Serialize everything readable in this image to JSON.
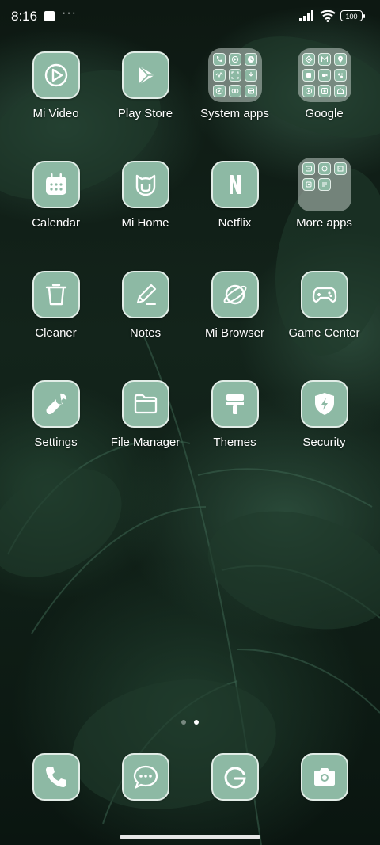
{
  "status_bar": {
    "time": "8:16",
    "overflow": "···",
    "battery": "100"
  },
  "apps": {
    "mi_video": "Mi Video",
    "play_store": "Play Store",
    "system_apps": "System apps",
    "google": "Google",
    "calendar": "Calendar",
    "mi_home": "Mi Home",
    "netflix": "Netflix",
    "more_apps": "More apps",
    "cleaner": "Cleaner",
    "notes": "Notes",
    "mi_browser": "Mi Browser",
    "game_center": "Game Center",
    "settings": "Settings",
    "file_manager": "File Manager",
    "themes": "Themes",
    "security": "Security"
  },
  "dock": {
    "icons": [
      "phone-icon",
      "messages-icon",
      "google-g-icon",
      "camera-icon"
    ]
  },
  "page_indicator": {
    "pages": 2,
    "current": 2
  },
  "colors": {
    "icon_bg": "#8db9a4",
    "icon_border": "#e2ede7",
    "label": "#ffffff"
  }
}
